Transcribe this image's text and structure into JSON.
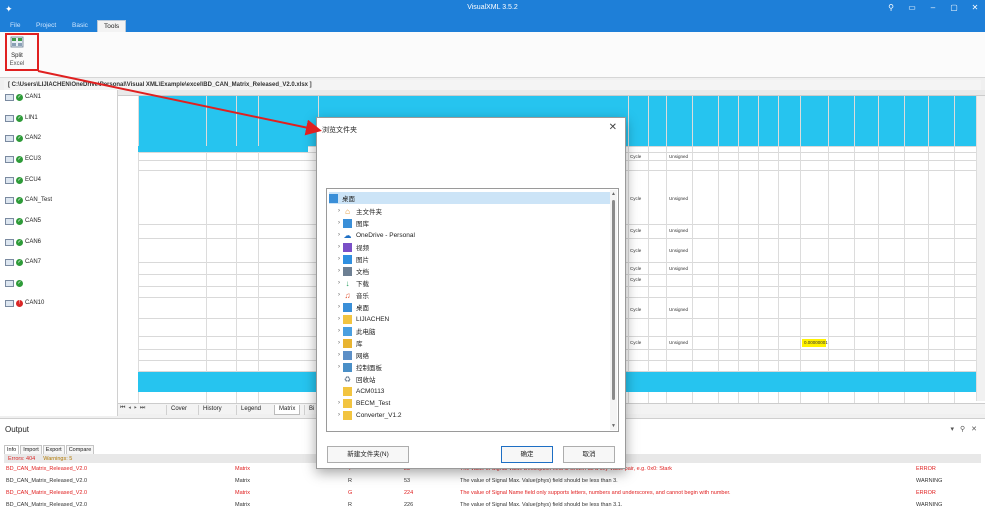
{
  "window": {
    "title": "VisualXML 3.5.2"
  },
  "menu": [
    "File",
    "Project",
    "Basic",
    "Tools"
  ],
  "ribbon": {
    "label1": "Split",
    "label2": "Excel"
  },
  "path": "[ C:\\Users\\LIJIACHEN\\OneDrive\\Personal\\Visual XML\\Example\\excel\\BD_CAN_Matrix_Released_V2.0.xlsx ]",
  "tree": [
    "CAN1",
    "LIN1",
    "CAN2",
    "ECU3",
    "ECU4",
    "CAN_Test",
    "CAN5",
    "CAN6",
    "CAN7",
    "",
    "CAN10"
  ],
  "sheet": {
    "sheet_tabs": [
      "Cover",
      "History",
      "Legend",
      "Matrix",
      "Bi"
    ],
    "cells": {
      "cycle": "Cycle",
      "unsigned": "Unsigned",
      "highlight": "0.00000001"
    }
  },
  "dialog": {
    "title": "浏览文件夹",
    "items": [
      "桌面",
      "主文件夹",
      "图库",
      "OneDrive - Personal",
      "视频",
      "图片",
      "文档",
      "下载",
      "音乐",
      "桌面",
      "LIJIACHEN",
      "此电脑",
      "库",
      "网络",
      "控制面板",
      "回收站",
      "ACM0113",
      "BECM_Test",
      "Converter_V1.2"
    ],
    "new_folder": "新建文件夹(N)",
    "ok": "确定",
    "cancel": "取消"
  },
  "output": {
    "title": "Output",
    "tabs": [
      "Info",
      "Import",
      "Export",
      "Compare"
    ],
    "errors": "Errors: 404",
    "warnings": "Warnings: 5",
    "rows": [
      {
        "file": "BD_CAN_Matrix_Released_V2.0",
        "sheet": "Matrix",
        "col": "Y",
        "row": "23",
        "msg": "The value of Signal Value Description field is written as a key-value pair, e.g. 0x0: Stark",
        "level": "ERROR"
      },
      {
        "file": "BD_CAN_Matrix_Released_V2.0",
        "sheet": "Matrix",
        "col": "R",
        "row": "53",
        "msg": "The value of Signal Max. Value(phys) field should be less than 3.",
        "level": "WARNING"
      },
      {
        "file": "BD_CAN_Matrix_Released_V2.0",
        "sheet": "Matrix",
        "col": "G",
        "row": "224",
        "msg": "The value of Signal Name field only supports letters, numbers and underscores, and cannot begin with number.",
        "level": "ERROR"
      },
      {
        "file": "BD_CAN_Matrix_Released_V2.0",
        "sheet": "Matrix",
        "col": "R",
        "row": "226",
        "msg": "The value of Signal Max. Value(phys) field should be less than 3.1.",
        "level": "WARNING"
      }
    ]
  },
  "colors": {
    "titlebar": "#1e7fd8",
    "header_cyan": "#26c4ef",
    "error": "#e02020",
    "highlight": "#fff200"
  }
}
